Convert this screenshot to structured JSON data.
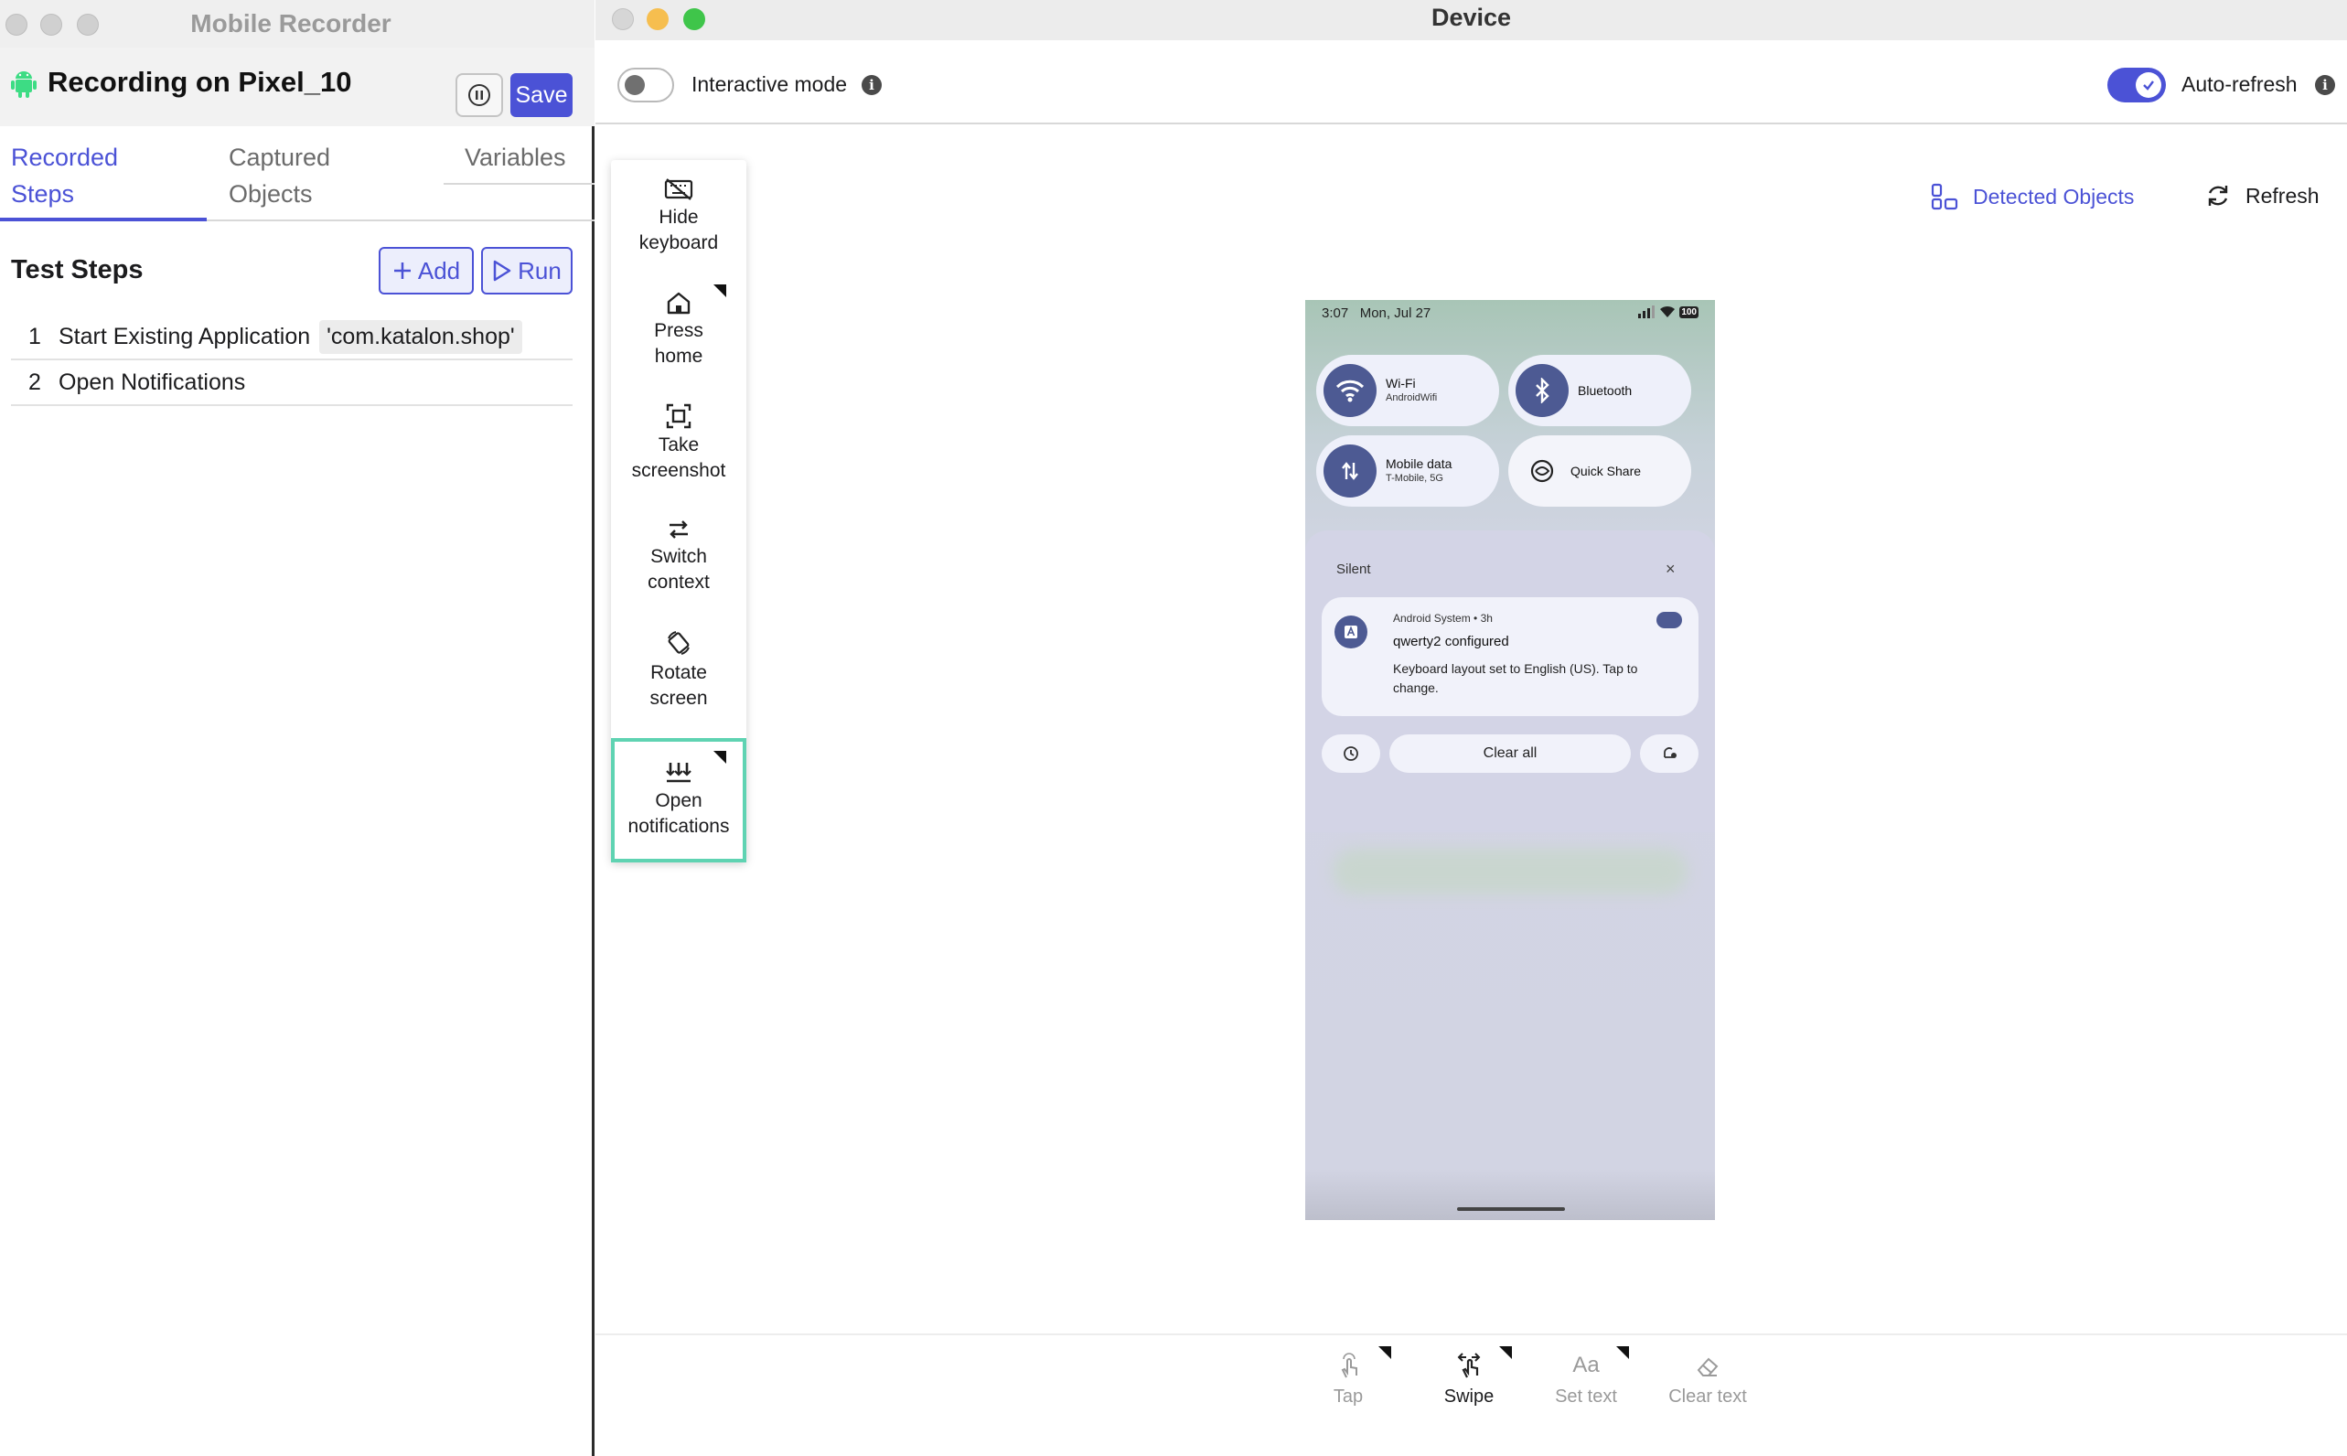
{
  "left_window": {
    "title": "Mobile Recorder",
    "recording_title": "Recording on Pixel_10",
    "save_label": "Save",
    "tabs": [
      {
        "line1": "Recorded",
        "line2": "Steps"
      },
      {
        "line1": "Captured",
        "line2": "Objects"
      },
      {
        "line1": "Variables",
        "line2": ""
      }
    ],
    "test_steps_title": "Test Steps",
    "add_label": "Add",
    "run_label": "Run",
    "steps": [
      {
        "num": "1",
        "label": "Start Existing Application",
        "arg": "'com.katalon.shop'"
      },
      {
        "num": "2",
        "label": "Open Notifications",
        "arg": ""
      }
    ]
  },
  "right_window": {
    "title": "Device",
    "interactive_mode_label": "Interactive mode",
    "auto_refresh_label": "Auto-refresh",
    "detected_objects_label": "Detected Objects",
    "refresh_label": "Refresh",
    "actions": [
      {
        "line1": "Hide",
        "line2": "keyboard",
        "icon": "keyboard-off-icon"
      },
      {
        "line1": "Press",
        "line2": "home",
        "icon": "home-icon"
      },
      {
        "line1": "Take",
        "line2": "screenshot",
        "icon": "screenshot-icon"
      },
      {
        "line1": "Switch",
        "line2": "context",
        "icon": "switch-context-icon"
      },
      {
        "line1": "Rotate",
        "line2": "screen",
        "icon": "rotate-icon"
      },
      {
        "line1": "Open",
        "line2": "notifications",
        "icon": "notifications-icon"
      }
    ],
    "bottom_tools": [
      {
        "label": "Tap",
        "icon": "tap-icon"
      },
      {
        "label": "Swipe",
        "icon": "swipe-icon"
      },
      {
        "label": "Set text",
        "icon": "set-text-icon"
      },
      {
        "label": "Clear text",
        "icon": "eraser-icon"
      }
    ],
    "set_text_glyph": "Aa"
  },
  "phone": {
    "time": "3:07",
    "date": "Mon, Jul 27",
    "battery": "100",
    "tiles": [
      {
        "title": "Wi-Fi",
        "sub": "AndroidWifi"
      },
      {
        "title": "Bluetooth",
        "sub": ""
      },
      {
        "title": "Mobile data",
        "sub": "T-Mobile, 5G"
      },
      {
        "title": "Quick Share",
        "sub": ""
      }
    ],
    "silent_label": "Silent",
    "notification": {
      "app": "Android System • 3h",
      "title": "qwerty2 configured",
      "body": "Keyboard layout set to English (US). Tap to change."
    },
    "clear_all_label": "Clear all"
  },
  "colors": {
    "accent": "#4b52d6",
    "selected_outline": "#5fd3b2",
    "android_green": "#3ddc84",
    "phone_tile_icon_bg": "#4d5a93"
  }
}
